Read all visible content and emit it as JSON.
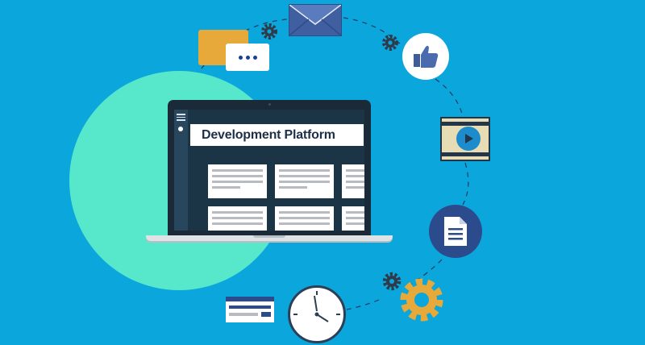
{
  "screen": {
    "title": "Development Platform"
  },
  "colors": {
    "background": "#0aa6dc",
    "accent_circle": "#57e8cc",
    "navy": "#2c4b8d",
    "gold": "#e6a93a",
    "dashed_ring": "#1a3a5a"
  },
  "icons": [
    "chat-bubbles-icon",
    "envelope-icon",
    "thumbs-up-icon",
    "video-player-icon",
    "document-icon",
    "gear-icon",
    "clock-icon",
    "form-window-icon"
  ]
}
